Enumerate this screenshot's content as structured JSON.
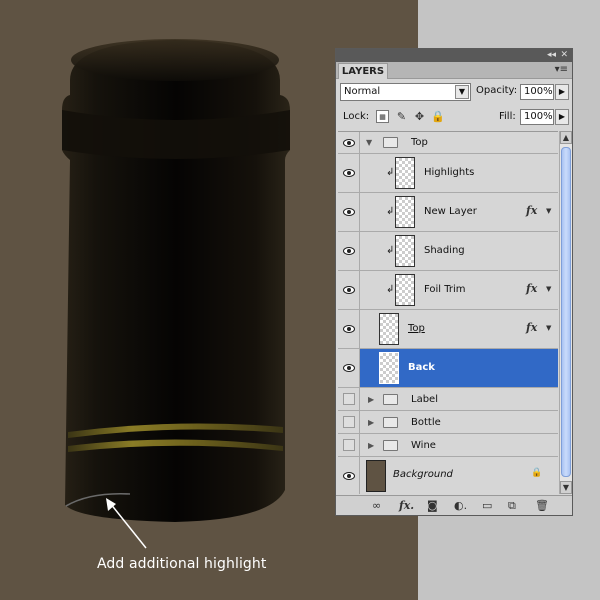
{
  "canvas": {
    "background_color": "#5f5343",
    "gray_strip_color": "#c4c4c4",
    "annotation": "Add additional highlight"
  },
  "layers_panel": {
    "tab_label": "LAYERS",
    "collapse_icon": "double-chevron-icon",
    "close_icon": "close-icon",
    "menu_icon": "panel-menu-icon",
    "blend_mode": "Normal",
    "opacity_label": "Opacity:",
    "opacity_value": "100%",
    "lock_label": "Lock:",
    "fill_label": "Fill:",
    "fill_value": "100%",
    "selected_color": "#3169c6",
    "layers": [
      {
        "name": "Top",
        "kind": "group",
        "expanded": true,
        "visible": true
      },
      {
        "name": "Highlights",
        "kind": "layer",
        "clipped": true,
        "fx": false,
        "visible": true
      },
      {
        "name": "New Layer",
        "kind": "layer",
        "clipped": true,
        "fx": true,
        "visible": true
      },
      {
        "name": "Shading",
        "kind": "layer",
        "clipped": true,
        "fx": false,
        "visible": true
      },
      {
        "name": "Foil Trim",
        "kind": "smart-layer",
        "clipped": true,
        "fx": true,
        "visible": true
      },
      {
        "name": "Top",
        "kind": "smart-layer",
        "clipped": false,
        "fx": true,
        "visible": true
      },
      {
        "name": "Back",
        "kind": "layer",
        "selected": true,
        "visible": true
      },
      {
        "name": "Label",
        "kind": "group",
        "expanded": false,
        "visible": false
      },
      {
        "name": "Bottle",
        "kind": "group",
        "expanded": false,
        "visible": false
      },
      {
        "name": "Wine",
        "kind": "group",
        "expanded": false,
        "visible": false
      },
      {
        "name": "Background",
        "kind": "background",
        "locked": true,
        "visible": true
      }
    ],
    "bottom_icons": [
      "link-icon",
      "fx-icon",
      "mask-icon",
      "adjustment-icon",
      "new-group-icon",
      "new-layer-icon",
      "trash-icon"
    ]
  }
}
